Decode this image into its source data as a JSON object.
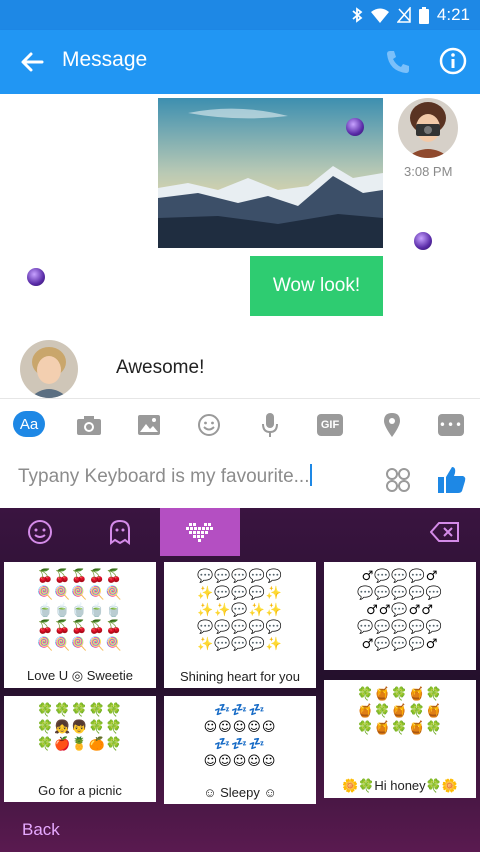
{
  "status_bar": {
    "time": "4:21",
    "icons": [
      "bluetooth-icon",
      "wifi-icon",
      "no-sim-icon",
      "battery-icon"
    ]
  },
  "app_bar": {
    "title": "Message",
    "icons": [
      "back-arrow-icon",
      "phone-icon",
      "info-icon"
    ],
    "color": "#2196f3"
  },
  "conversation": {
    "outgoing_time": "3:08 PM",
    "outgoing_message": "Wow look!",
    "incoming_message": "Awesome!",
    "outgoing_bubble_color": "#2ecc71"
  },
  "composer": {
    "toolbar_items": [
      {
        "name": "text-style-button",
        "label": "Aa"
      },
      {
        "name": "camera-icon",
        "label": ""
      },
      {
        "name": "gallery-icon",
        "label": ""
      },
      {
        "name": "emoji-icon",
        "label": ""
      },
      {
        "name": "microphone-icon",
        "label": ""
      },
      {
        "name": "gif-button",
        "label": "GIF"
      },
      {
        "name": "location-icon",
        "label": ""
      },
      {
        "name": "more-icon",
        "label": "•••"
      }
    ],
    "input_text": "Typany Keyboard is my favourite..."
  },
  "keyboard": {
    "tabs": [
      "smiley-icon",
      "ghost-icon",
      "heart-sticker-icon"
    ],
    "active_tab": 2,
    "stickers": [
      {
        "label": "Love U ◎ Sweetie",
        "glyphs": "🍒🍒🍒🍒🍒\n🍭🍭🍭🍭🍭\n🍵🍵🍵🍵🍵\n🍒🍒🍒🍒🍒\n🍭🍭🍭🍭🍭"
      },
      {
        "label": "Shining heart for you",
        "glyphs": "💬💬💬💬💬\n✨💬💬💬✨\n✨✨💬✨✨\n💬💬💬💬💬\n✨💬💬💬✨"
      },
      {
        "label": "",
        "glyphs": "♂💬💬💬♂\n💬💬💬💬💬\n♂♂💬♂♂\n💬💬💬💬💬\n♂💬💬💬♂"
      },
      {
        "label": "Go for a picnic",
        "glyphs": "🍀🍀🍀🍀🍀\n🍀👧👦🍀🍀\n🍀🍎🍍🍊🍀"
      },
      {
        "label": "☺ Sleepy ☺",
        "glyphs": "💤💤💤\n☺☺☺☺☺\n💤💤💤\n☺☺☺☺☺"
      },
      {
        "label": "🌼🍀Hi honey🍀🌼",
        "glyphs": "🍀🍯🍀🍯🍀\n🍯🍀🍯🍀🍯\n🍀🍯🍀🍯🍀"
      }
    ],
    "back_label": "Back",
    "accent": "#b44fc2"
  }
}
